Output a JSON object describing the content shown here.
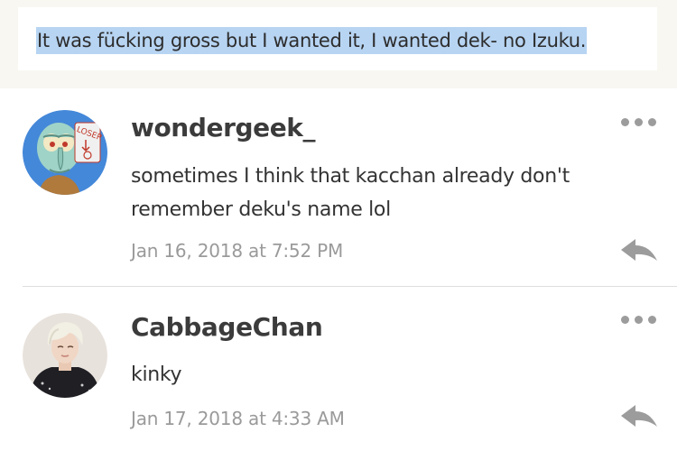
{
  "quote": {
    "text": "It was fücking gross but I wanted it, I wanted dek- no Izuku."
  },
  "colors": {
    "highlight": "#b7d4f2",
    "page_bg": "#f8f7f2",
    "meta_gray": "#9a9a9a",
    "icon_gray": "#9c9c9c"
  },
  "comments": [
    {
      "username": "wondergeek_",
      "body": "sometimes I think that kacchan already don't remember deku's name lol",
      "timestamp": "Jan 16, 2018 at 7:52 PM",
      "avatar_badge": "LOSER",
      "avatar_icon": "cartoon-character-avatar"
    },
    {
      "username": "CabbageChan",
      "body": "kinky",
      "timestamp": "Jan 17, 2018 at 4:33 AM",
      "avatar_icon": "person-photo-avatar"
    }
  ],
  "icons": {
    "more": "more-options-icon",
    "reply": "reply-icon"
  }
}
